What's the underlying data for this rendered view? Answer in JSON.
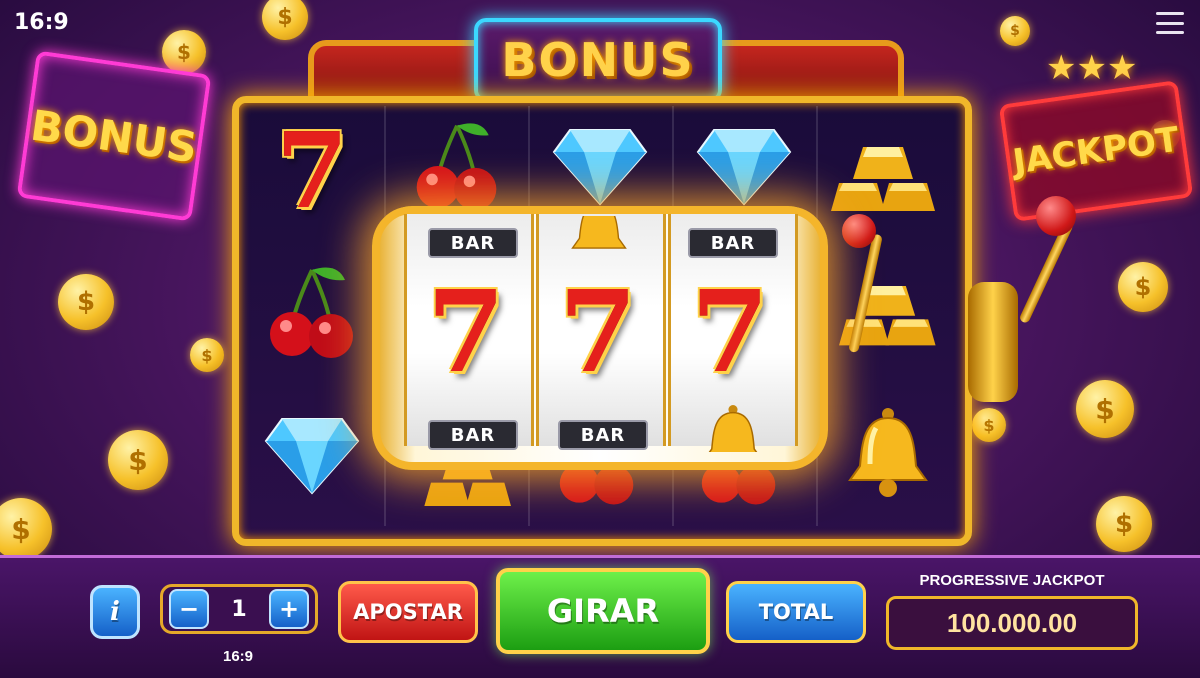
{
  "status_bar": {
    "aspect_label": "16:9"
  },
  "signs": {
    "top_bonus": "BONUS",
    "left_bonus": "BONUS",
    "right_jackpot": "JACKPOT"
  },
  "reels": {
    "left_symbols": [
      "7",
      "cherry",
      "diamond"
    ],
    "col2_symbols": [
      "cherry",
      "",
      ""
    ],
    "col3_symbols": [
      "diamond",
      "",
      ""
    ],
    "col4_symbols": [
      "diamond",
      "",
      ""
    ],
    "right_symbols": [
      "gold-bars",
      "gold-bars",
      "bell"
    ],
    "center_top": [
      "BAR",
      "bell",
      "BAR"
    ],
    "center_mid": [
      "7",
      "7",
      "7"
    ],
    "center_bottom": [
      "BAR",
      "BAR",
      "bell"
    ]
  },
  "controls": {
    "info_label": "i",
    "bet_minus": "−",
    "bet_value": "1",
    "bet_plus": "+",
    "bet_caption": "16:9",
    "apostar_label": "APOSTAR",
    "girar_label": "GIRAR",
    "total_label": "TOTAL"
  },
  "jackpot": {
    "title": "PROGRESSIVE JACKPOT",
    "value": "100.000.00"
  },
  "colors": {
    "accent_gold": "#f0b72a",
    "neon_pink": "#ff3bd5",
    "neon_blue": "#3bd8ff",
    "spin_green": "#1c9e12",
    "bet_red": "#c01414",
    "info_blue": "#1560c8"
  }
}
